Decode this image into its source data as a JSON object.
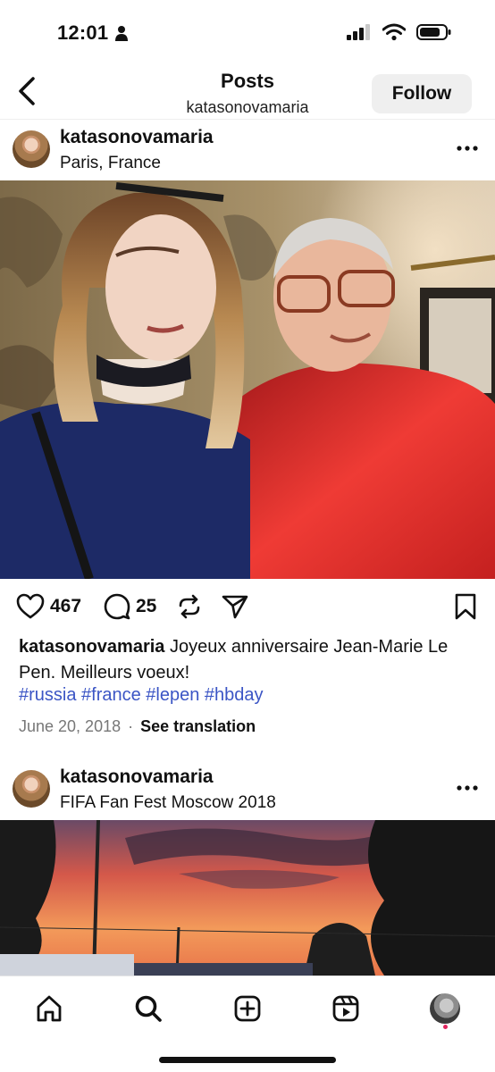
{
  "status_bar": {
    "time": "12:01"
  },
  "header": {
    "title": "Posts",
    "subtitle": "katasonovamaria",
    "follow_label": "Follow"
  },
  "posts": [
    {
      "username": "katasonovamaria",
      "location": "Paris, France",
      "likes": "467",
      "comments": "25",
      "caption_text": " Joyeux anniversaire Jean-Marie Le Pen. Meilleurs voeux!",
      "hashtags": "#russia #france #lepen #hbday",
      "date": "June 20, 2018",
      "translation_label": "See translation"
    },
    {
      "username": "katasonovamaria",
      "location": "FIFA Fan Fest Moscow 2018"
    }
  ],
  "colors": {
    "hashtag": "#3b55c5",
    "follow_bg": "#efefef",
    "notification_dot": "#e0245e"
  },
  "bottom_nav": [
    "home-icon",
    "search-icon",
    "new-post-icon",
    "reels-icon",
    "profile-avatar"
  ]
}
